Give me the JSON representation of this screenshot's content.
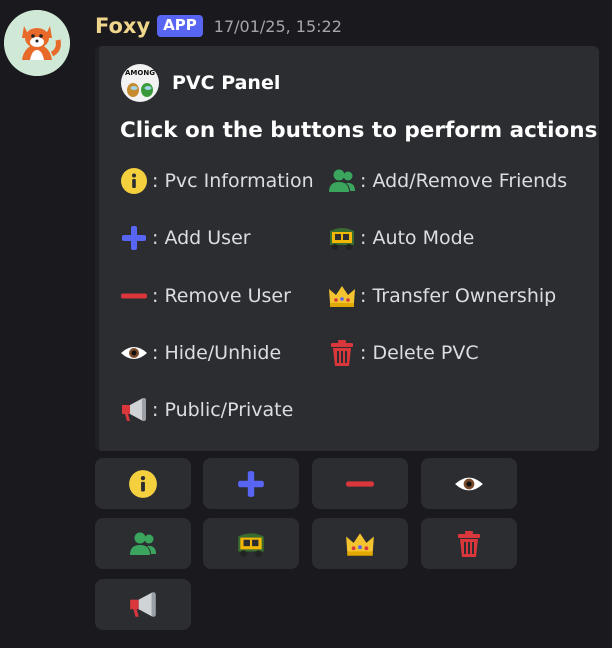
{
  "message": {
    "username": "Foxy",
    "badge": "APP",
    "timestamp": "17/01/25, 15:22"
  },
  "embed": {
    "author_name": "PVC Panel",
    "author_icon_text": "AMONG",
    "description_title": "Click on the buttons to perform actions",
    "legend": [
      {
        "icon": "info-icon",
        "label": ": Pvc Information"
      },
      {
        "icon": "add-user-icon",
        "label": ": Add User"
      },
      {
        "icon": "remove-user-icon",
        "label": ": Remove User"
      },
      {
        "icon": "eye-icon",
        "label": ": Hide/Unhide"
      },
      {
        "icon": "megaphone-icon",
        "label": ": Public/Private"
      },
      {
        "icon": "friends-icon",
        "label": ": Add/Remove Friends"
      },
      {
        "icon": "auto-rickshaw-icon",
        "label": ": Auto Mode"
      },
      {
        "icon": "crown-icon",
        "label": ": Transfer Ownership"
      },
      {
        "icon": "trash-icon",
        "label": ": Delete PVC"
      }
    ]
  },
  "buttons": [
    {
      "icon": "info-icon"
    },
    {
      "icon": "plus-icon"
    },
    {
      "icon": "minus-icon"
    },
    {
      "icon": "eye-icon"
    },
    {
      "icon": "friends-icon"
    },
    {
      "icon": "auto-rickshaw-icon"
    },
    {
      "icon": "crown-icon"
    },
    {
      "icon": "trash-icon"
    },
    {
      "icon": "megaphone-icon"
    }
  ],
  "colors": {
    "background": "#1a1a1e",
    "embed_background": "#2b2d31",
    "username": "#f0d58c",
    "badge": "#5865f2",
    "plus": "#5865f2",
    "minus": "#da373c",
    "friends": "#3ba55d",
    "trash": "#da373c"
  }
}
